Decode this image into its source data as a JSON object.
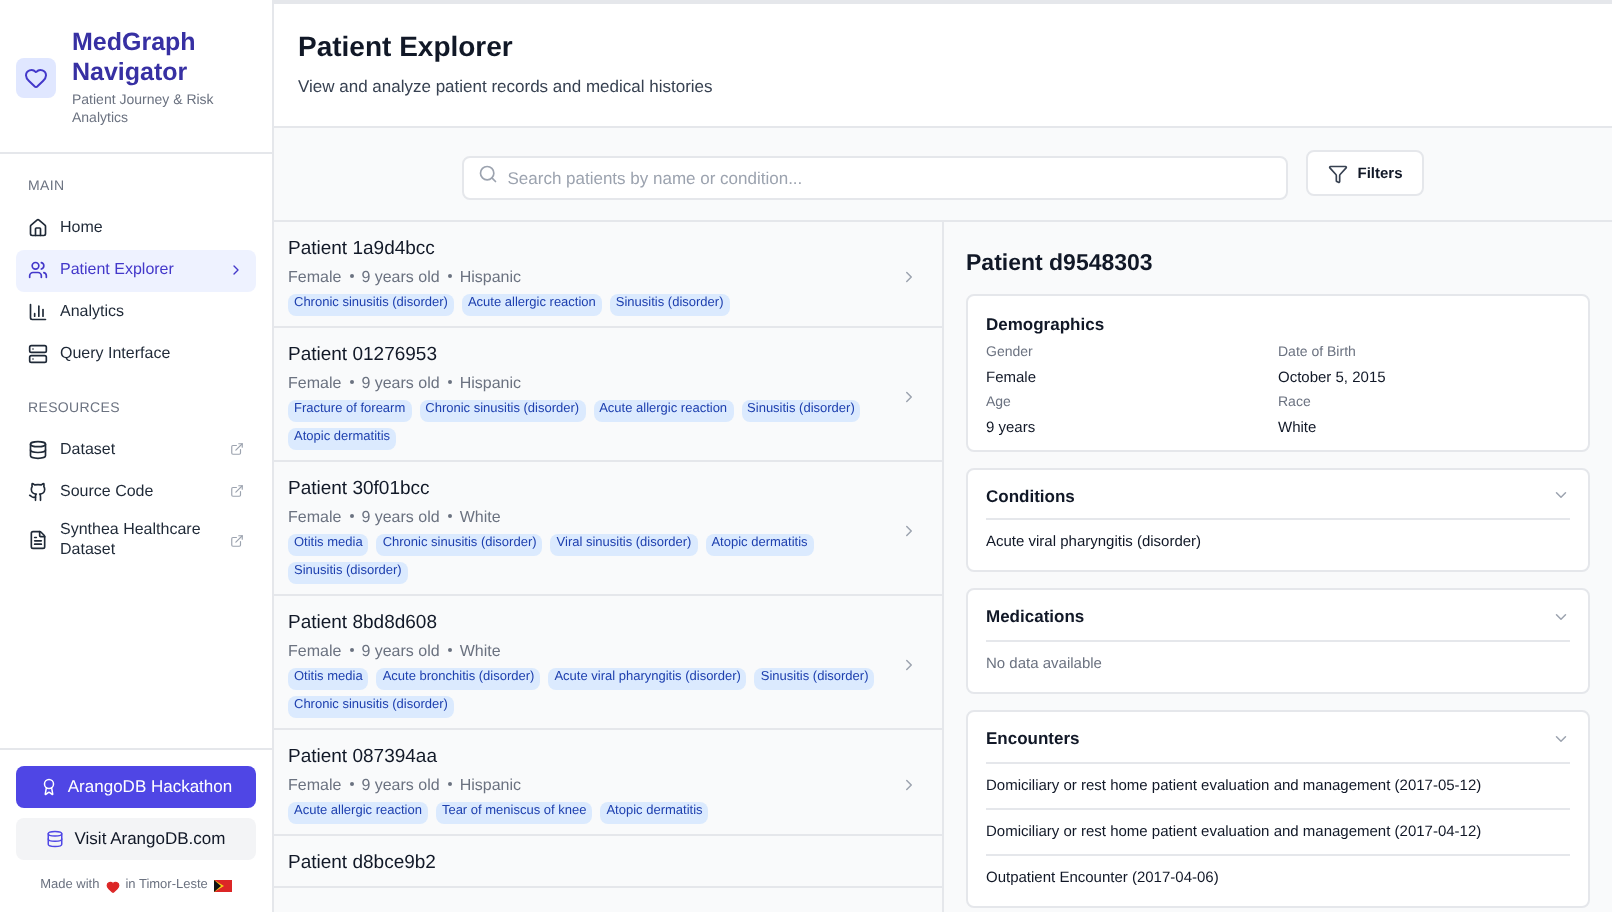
{
  "brand": {
    "title": "MedGraph Navigator",
    "subtitle": "Patient Journey & Risk Analytics"
  },
  "sidebar": {
    "sections": [
      {
        "heading": "MAIN",
        "items": [
          {
            "label": "Home",
            "selected": false
          },
          {
            "label": "Patient Explorer",
            "selected": true
          },
          {
            "label": "Analytics",
            "selected": false
          },
          {
            "label": "Query Interface",
            "selected": false
          }
        ]
      },
      {
        "heading": "RESOURCES",
        "items": [
          {
            "label": "Dataset",
            "selected": false
          },
          {
            "label": "Source Code",
            "selected": false
          },
          {
            "label": "Synthea Healthcare Dataset",
            "selected": false
          }
        ]
      }
    ],
    "primary_button": "ArangoDB Hackathon",
    "secondary_button": "Visit ArangoDB.com",
    "footer": {
      "before": "Made with",
      "after": "in Timor-Leste"
    }
  },
  "header": {
    "title": "Patient Explorer",
    "subtitle": "View and analyze patient records and medical histories"
  },
  "search": {
    "placeholder": "Search patients by name or condition...",
    "filter_button": "Filters"
  },
  "patients": [
    {
      "name": "Patient 1a9d4bcc",
      "meta": [
        "Female",
        "9 years old",
        "Hispanic"
      ],
      "tags": [
        "Chronic sinusitis (disorder)",
        "Acute allergic reaction",
        "Sinusitis (disorder)"
      ]
    },
    {
      "name": "Patient 01276953",
      "meta": [
        "Female",
        "9 years old",
        "Hispanic"
      ],
      "tags": [
        "Fracture of forearm",
        "Chronic sinusitis (disorder)",
        "Acute allergic reaction",
        "Sinusitis (disorder)",
        "Atopic dermatitis"
      ]
    },
    {
      "name": "Patient 30f01bcc",
      "meta": [
        "Female",
        "9 years old",
        "White"
      ],
      "tags": [
        "Otitis media",
        "Chronic sinusitis (disorder)",
        "Viral sinusitis (disorder)",
        "Atopic dermatitis",
        "Sinusitis (disorder)"
      ]
    },
    {
      "name": "Patient 8bd8d608",
      "meta": [
        "Female",
        "9 years old",
        "White"
      ],
      "tags": [
        "Otitis media",
        "Acute bronchitis (disorder)",
        "Acute viral pharyngitis (disorder)",
        "Sinusitis (disorder)",
        "Chronic sinusitis (disorder)"
      ]
    },
    {
      "name": "Patient 087394aa",
      "meta": [
        "Female",
        "9 years old",
        "Hispanic"
      ],
      "tags": [
        "Acute allergic reaction",
        "Tear of meniscus of knee",
        "Atopic dermatitis"
      ]
    },
    {
      "name": "Patient d8bce9b2"
    }
  ],
  "detail": {
    "title": "Patient d9548303",
    "demographics": {
      "heading": "Demographics",
      "fields": [
        {
          "label": "Gender",
          "value": "Female"
        },
        {
          "label": "Date of Birth",
          "value": "October 5, 2015"
        },
        {
          "label": "Age",
          "value": "9 years"
        },
        {
          "label": "Race",
          "value": "White"
        }
      ]
    },
    "sections": [
      {
        "heading": "Conditions",
        "items": [
          "Acute viral pharyngitis (disorder)"
        ]
      },
      {
        "heading": "Medications",
        "empty_text": "No data available"
      },
      {
        "heading": "Encounters",
        "items": [
          "Domiciliary or rest home patient evaluation and management (2017-05-12)",
          "Domiciliary or rest home patient evaluation and management (2017-04-12)",
          "Outpatient Encounter (2017-04-06)"
        ]
      }
    ]
  }
}
